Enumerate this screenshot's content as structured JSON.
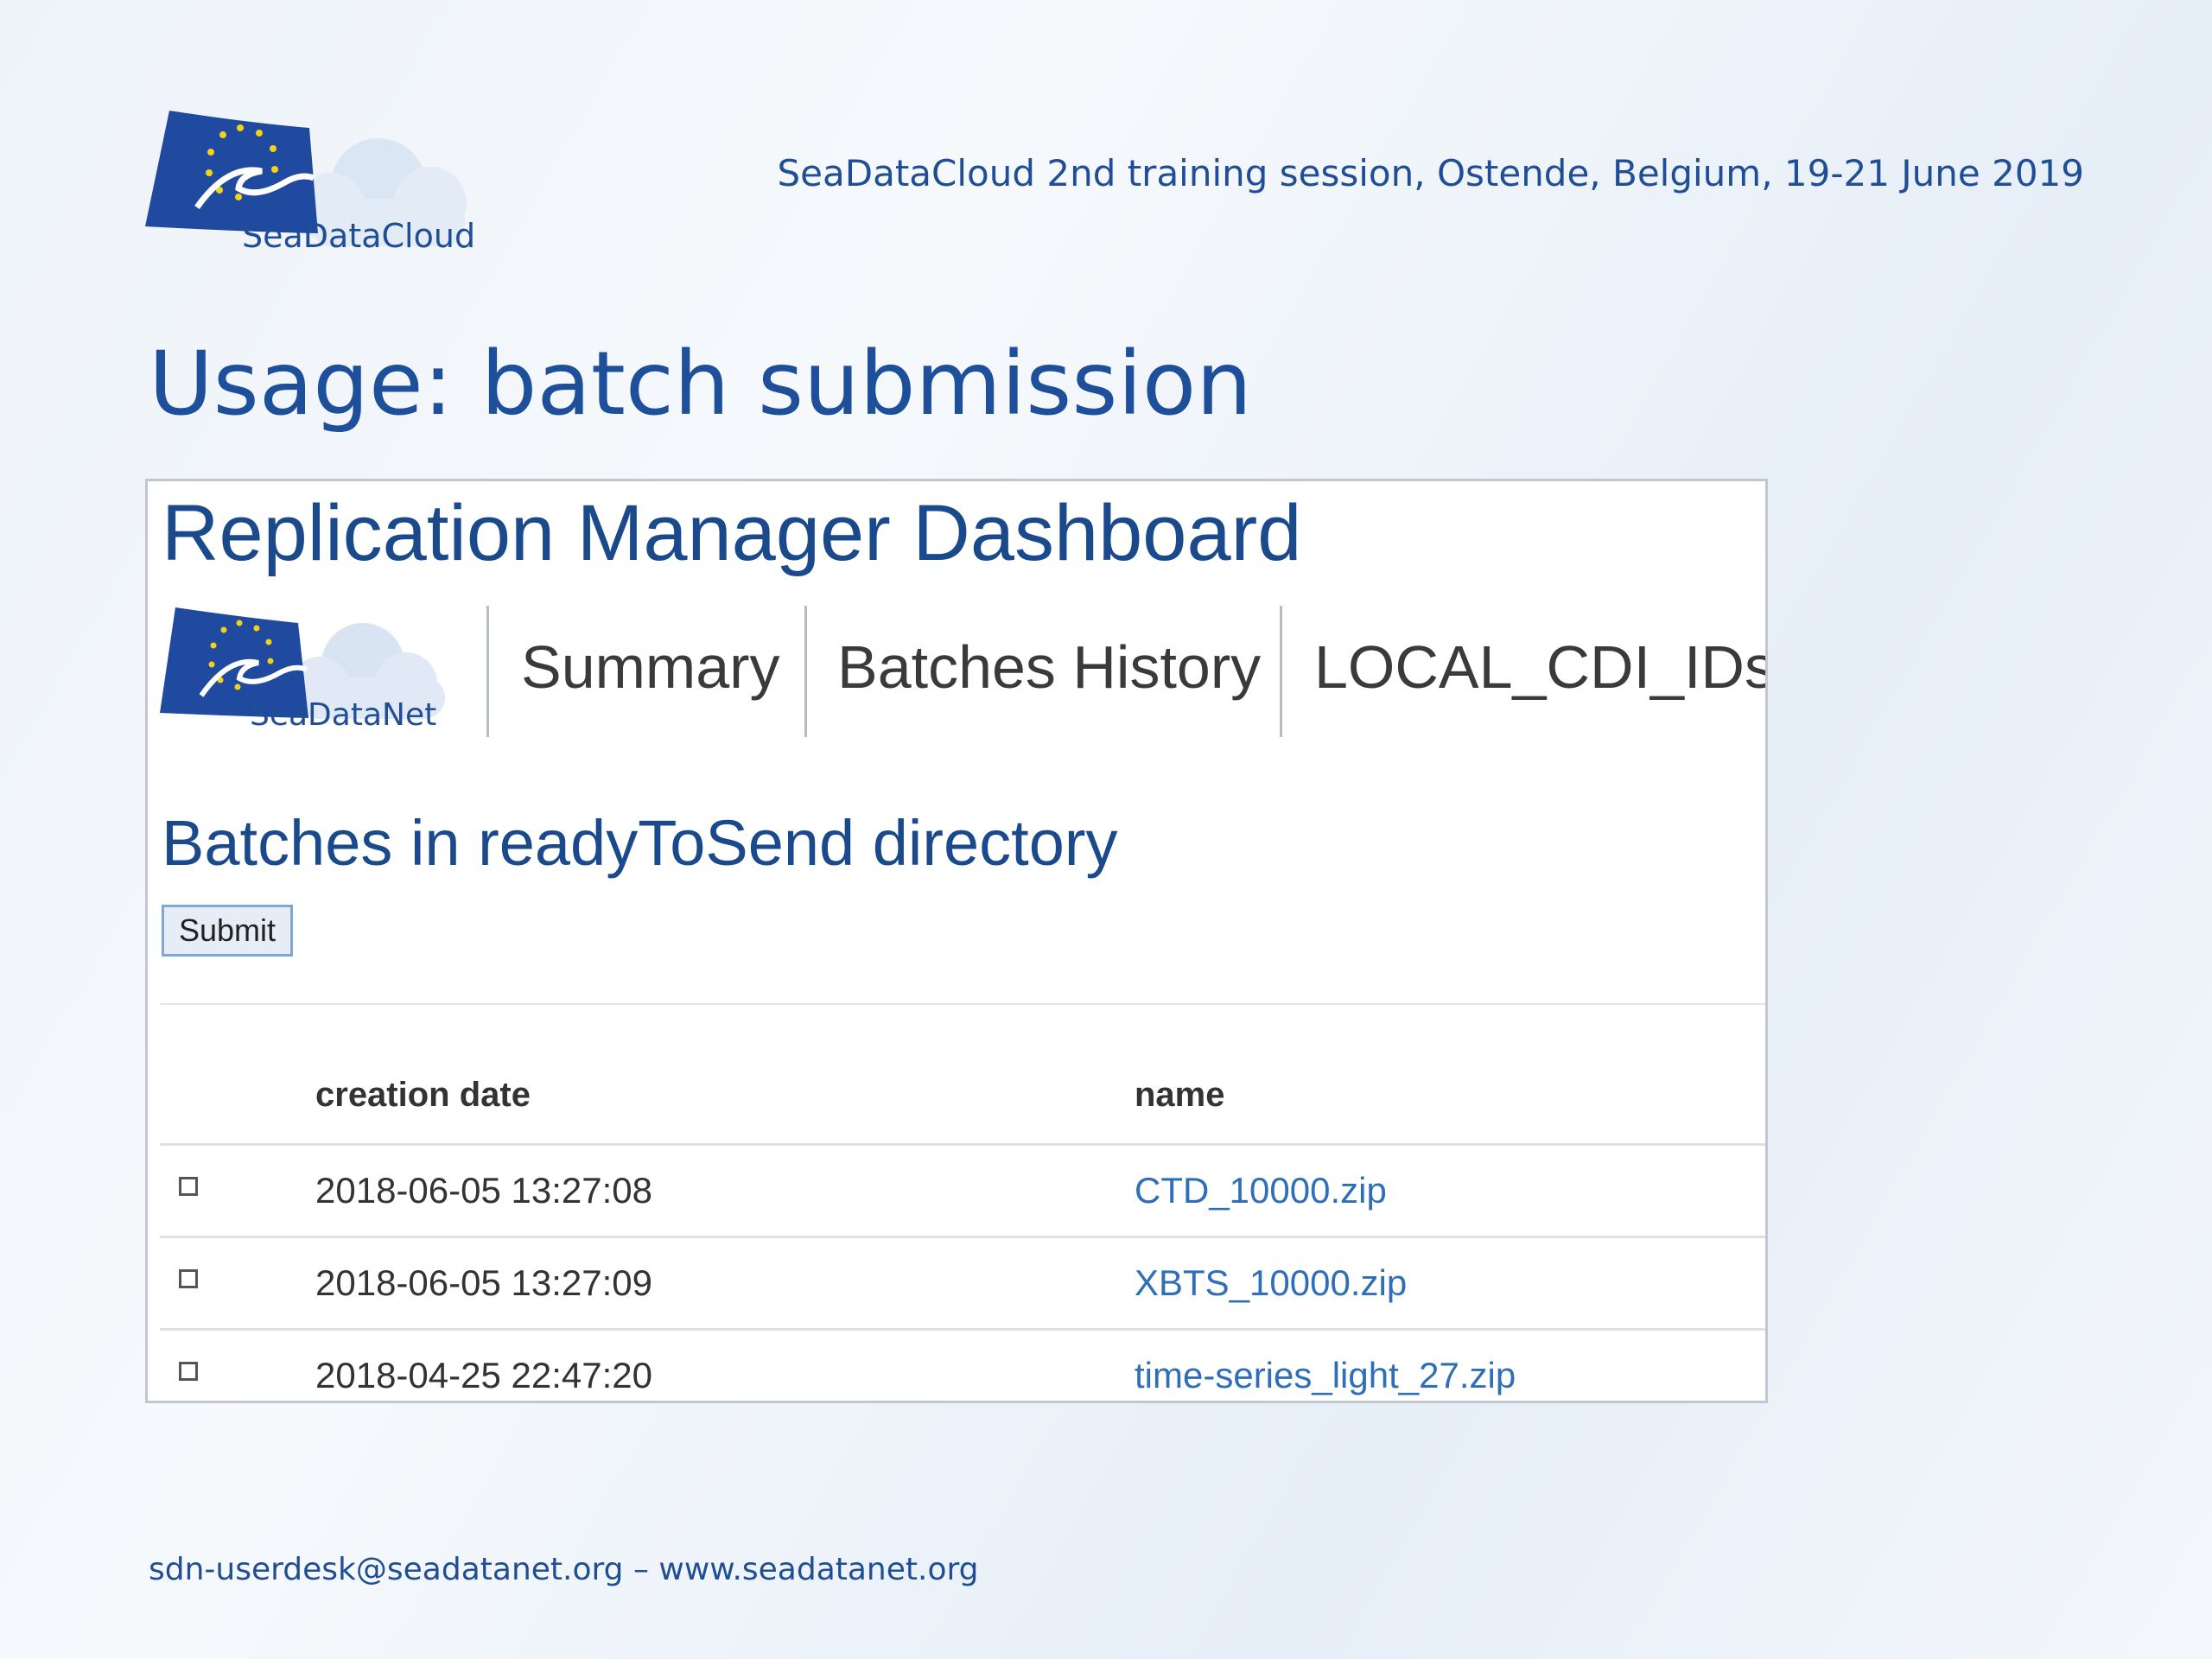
{
  "slide": {
    "logo_label": "SeaDataCloud",
    "header": "SeaDataCloud 2nd training session, Ostende, Belgium, 19-21 June 2019",
    "title": "Usage: batch submission",
    "footer": "sdn-userdesk@seadatanet.org – www.seadatanet.org"
  },
  "dashboard": {
    "title": "Replication Manager Dashboard",
    "logo_label": "SeaDataNet",
    "nav": [
      {
        "label": "Summary"
      },
      {
        "label": "Batches History"
      },
      {
        "label": "LOCAL_CDI_IDs"
      }
    ],
    "section_heading": "Batches in readyToSend directory",
    "submit_label": "Submit",
    "table": {
      "columns": [
        "",
        "creation date",
        "name"
      ],
      "rows": [
        {
          "date": "2018-06-05 13:27:08",
          "name": "CTD_10000.zip",
          "checked": false
        },
        {
          "date": "2018-06-05 13:27:09",
          "name": "XBTS_10000.zip",
          "checked": false
        },
        {
          "date": "2018-04-25 22:47:20",
          "name": "time-series_light_27.zip",
          "checked": false
        }
      ]
    }
  },
  "colors": {
    "brand_blue": "#1d4f9a",
    "flag_blue": "#1f4aa0",
    "star_yellow": "#f5d21a",
    "link_blue": "#2f6fb8"
  }
}
